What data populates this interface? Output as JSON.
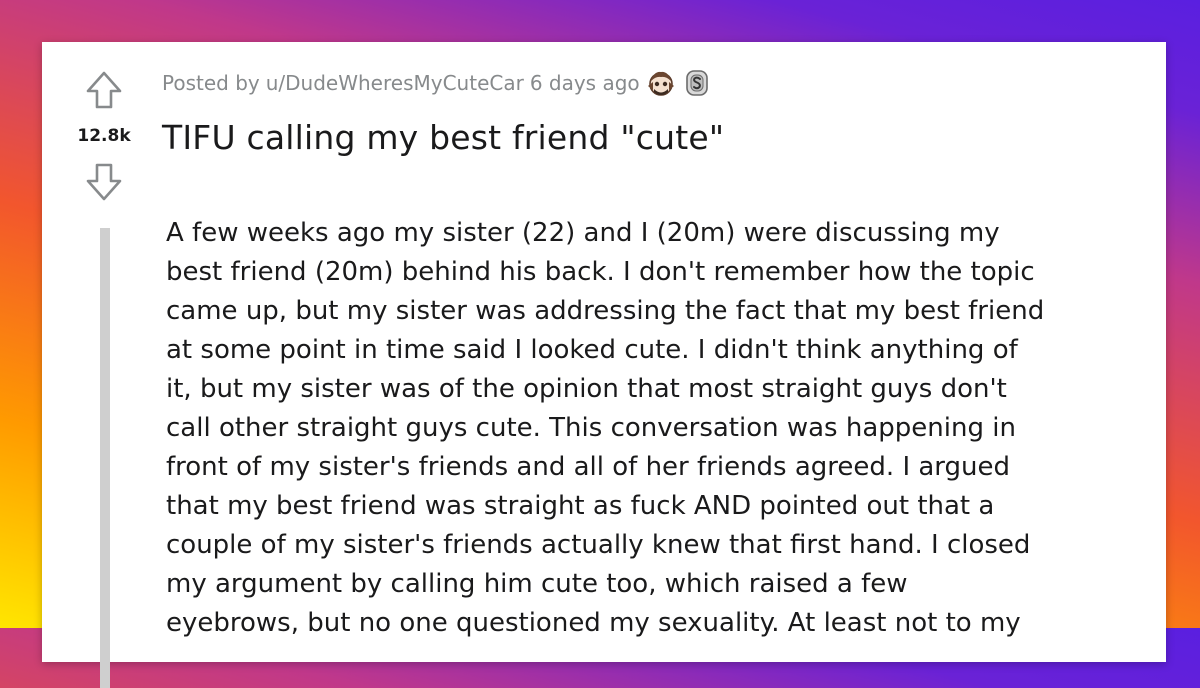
{
  "post": {
    "posted_by_prefix": "Posted by",
    "author": "u/DudeWheresMyCuteCar",
    "age": "6 days ago",
    "awards": [
      "helpful-award-icon",
      "silver-award-icon"
    ],
    "score": "12.8k",
    "title": "TIFU calling my best friend \"cute\"",
    "body_lines": [
      "A few weeks ago my sister (22) and I (20m) were discussing my",
      "best friend (20m) behind his back. I don't remember how the topic",
      "came up, but my sister was addressing the fact that my best friend",
      "at some point in time said I looked cute. I didn't think anything of",
      "it, but my sister was of the opinion that most straight guys don't",
      "call other straight guys cute. This conversation was happening in",
      "front of my sister's friends and all of her friends agreed. I argued",
      "that my best friend was straight as fuck AND pointed out that a",
      "couple of my sister's friends actually knew that first hand. I closed",
      "my argument by calling him cute too, which raised a few",
      "eyebrows, but no one questioned my sexuality. At least not to my"
    ]
  },
  "icons": {
    "upvote": "upvote-arrow-icon",
    "downvote": "downvote-arrow-icon"
  },
  "colors": {
    "text": "#1a1a1b",
    "meta": "#878a8c",
    "thread_line": "#cfcfcf",
    "card": "#ffffff"
  }
}
